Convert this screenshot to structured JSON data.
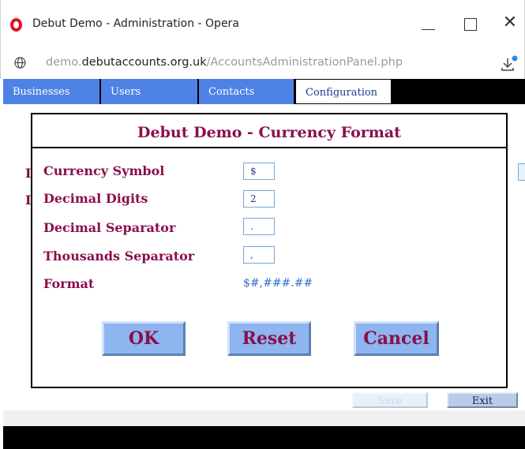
{
  "window": {
    "title": "Debut Demo - Administration - Opera",
    "close_glyph": "✕"
  },
  "address": {
    "scheme_part": "demo.",
    "host": "debutaccounts.org.uk",
    "path": "/AccountsAdministrationPanel.php"
  },
  "tabs": [
    {
      "label": "Businesses"
    },
    {
      "label": "Users"
    },
    {
      "label": "Contacts"
    },
    {
      "label": "Configuration"
    }
  ],
  "background": {
    "label_initial_1": "I",
    "label_initial_2": "I",
    "save_label": "Save",
    "exit_label": "Exit"
  },
  "dialog": {
    "title": "Debut Demo - Currency Format",
    "currency_symbol_label": "Currency Symbol",
    "currency_symbol_value": "$",
    "decimal_digits_label": "Decimal Digits",
    "decimal_digits_value": "2",
    "decimal_separator_label": "Decimal Separator",
    "decimal_separator_value": ".",
    "thousands_separator_label": "Thousands Separator",
    "thousands_separator_value": ",",
    "format_label": "Format",
    "format_value": "$#,###.##",
    "ok_label": "OK",
    "reset_label": "Reset",
    "cancel_label": "Cancel"
  },
  "colors": {
    "accent_maroon": "#8a0f4a",
    "tab_blue": "#4f82e5",
    "button_blue": "#8db5ef",
    "opera_red": "#e0141e"
  }
}
